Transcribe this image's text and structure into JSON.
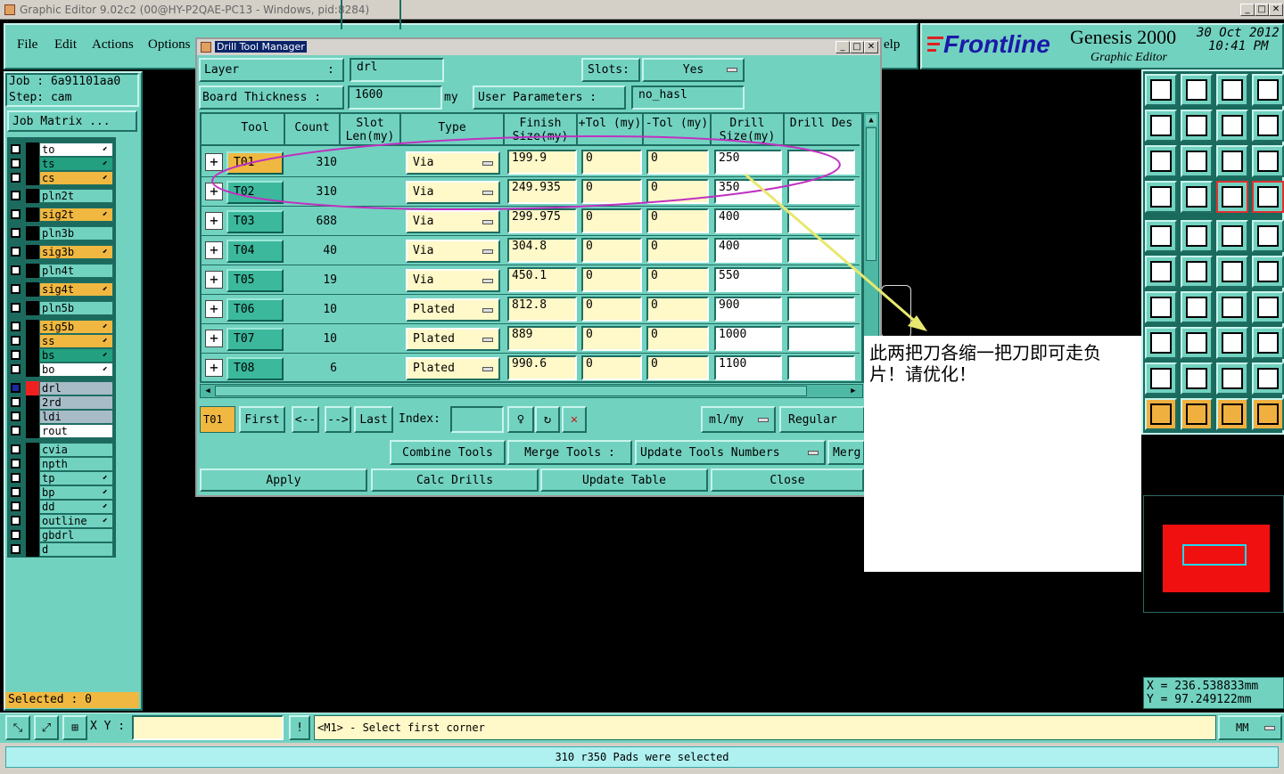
{
  "app": {
    "title": "Graphic Editor 9.02c2 (00@HY-P2QAE-PC13 - Windows, pid:8284)",
    "menu": [
      "File",
      "Edit",
      "Actions",
      "Options"
    ],
    "help_fragment": "elp",
    "brand": "Frontline",
    "product": "Genesis 2000",
    "subtitle": "Graphic Editor",
    "date": "30 Oct 2012",
    "time": "10:41 PM"
  },
  "job": {
    "job_label": "Job : 6a91101aa0",
    "step_label": "Step: cam",
    "matrix_button": "Job Matrix ..."
  },
  "layers": [
    {
      "name": "to",
      "color": "#ffffff",
      "arrow": true
    },
    {
      "name": "ts",
      "color": "#22a080",
      "arrow": true
    },
    {
      "name": "cs",
      "color": "#f0b840",
      "arrow": true
    },
    {
      "name": "pln2t",
      "color": "#72d2c0",
      "arrow": false
    },
    {
      "name": "sig2t",
      "color": "#f0b840",
      "arrow": true
    },
    {
      "name": "pln3b",
      "color": "#72d2c0",
      "arrow": false
    },
    {
      "name": "sig3b",
      "color": "#f0b840",
      "arrow": true
    },
    {
      "name": "pln4t",
      "color": "#72d2c0",
      "arrow": false
    },
    {
      "name": "sig4t",
      "color": "#f0b840",
      "arrow": true
    },
    {
      "name": "pln5b",
      "color": "#72d2c0",
      "arrow": false
    },
    {
      "name": "sig5b",
      "color": "#f0b840",
      "arrow": true
    },
    {
      "name": "ss",
      "color": "#f0b840",
      "arrow": true
    },
    {
      "name": "bs",
      "color": "#22a080",
      "arrow": true
    },
    {
      "name": "bo",
      "color": "#ffffff",
      "arrow": true
    },
    {
      "name": "drl",
      "color": "#a8bcc8",
      "arrow": false
    },
    {
      "name": "2rd",
      "color": "#a8bcc8",
      "arrow": false
    },
    {
      "name": "ldi",
      "color": "#a8bcc8",
      "arrow": false
    },
    {
      "name": "rout",
      "color": "#ffffff",
      "arrow": false
    },
    {
      "name": "cvia",
      "color": "#72d2c0",
      "arrow": false
    },
    {
      "name": "npth",
      "color": "#72d2c0",
      "arrow": false
    },
    {
      "name": "tp",
      "color": "#72d2c0",
      "arrow": true
    },
    {
      "name": "bp",
      "color": "#72d2c0",
      "arrow": true
    },
    {
      "name": "dd",
      "color": "#72d2c0",
      "arrow": true
    },
    {
      "name": "outline",
      "color": "#72d2c0",
      "arrow": true
    },
    {
      "name": "gbdrl",
      "color": "#72d2c0",
      "arrow": false
    },
    {
      "name": "d",
      "color": "#72d2c0",
      "arrow": false
    }
  ],
  "selected_label": "Selected : 0",
  "dialog": {
    "title": "Drill Tool Manager",
    "layer_label": "Layer",
    "layer_colon": ":",
    "layer_value": "drl",
    "slots_label": "Slots:",
    "slots_value": "Yes",
    "thickness_label": "Board Thickness :",
    "thickness_value": "1600",
    "thickness_unit": "my",
    "user_params_label": "User Parameters :",
    "user_params_value": "no_hasl",
    "headers": [
      "Tool",
      "Count",
      "Slot Len(my)",
      "Type",
      "Finish Size(my)",
      "+Tol (my)",
      "-Tol (my)",
      "Drill Size(my)",
      "Drill Des"
    ],
    "rows": [
      {
        "tool": "T01",
        "count": "310",
        "type": "Via",
        "finish": "199.9",
        "ptol": "0",
        "ntol": "0",
        "drill": "250"
      },
      {
        "tool": "T02",
        "count": "310",
        "type": "Via",
        "finish": "249.935",
        "ptol": "0",
        "ntol": "0",
        "drill": "350"
      },
      {
        "tool": "T03",
        "count": "688",
        "type": "Via",
        "finish": "299.975",
        "ptol": "0",
        "ntol": "0",
        "drill": "400"
      },
      {
        "tool": "T04",
        "count": "40",
        "type": "Via",
        "finish": "304.8",
        "ptol": "0",
        "ntol": "0",
        "drill": "400"
      },
      {
        "tool": "T05",
        "count": "19",
        "type": "Via",
        "finish": "450.1",
        "ptol": "0",
        "ntol": "0",
        "drill": "550"
      },
      {
        "tool": "T06",
        "count": "10",
        "type": "Plated",
        "finish": "812.8",
        "ptol": "0",
        "ntol": "0",
        "drill": "900"
      },
      {
        "tool": "T07",
        "count": "10",
        "type": "Plated",
        "finish": "889",
        "ptol": "0",
        "ntol": "0",
        "drill": "1000"
      },
      {
        "tool": "T08",
        "count": "6",
        "type": "Plated",
        "finish": "990.6",
        "ptol": "0",
        "ntol": "0",
        "drill": "1100"
      }
    ],
    "nav": {
      "current": "T01",
      "first": "First",
      "prev": "<--",
      "next": "-->",
      "last": "Last",
      "index_label": "Index:",
      "units": "ml/my",
      "mode": "Regular"
    },
    "actions": {
      "combine": "Combine Tools",
      "merge": "Merge Tools :",
      "update_numbers": "Update Tools Numbers",
      "merge_fragment": "Merg",
      "apply": "Apply",
      "calc": "Calc Drills",
      "update_table": "Update Table",
      "close": "Close"
    }
  },
  "annotation": {
    "text": "此两把刀各缩一把刀即可走负片！请优化！",
    "ellipse_color": "#c030c0",
    "arrow_color": "#e8e870"
  },
  "coords": {
    "x": "X = 236.538833mm",
    "y": "Y = 97.249122mm"
  },
  "bottom": {
    "xy_label": "X Y :",
    "prompt": "<M1> - Select first corner",
    "units": "MM",
    "status": "310 r350 Pads were selected"
  }
}
